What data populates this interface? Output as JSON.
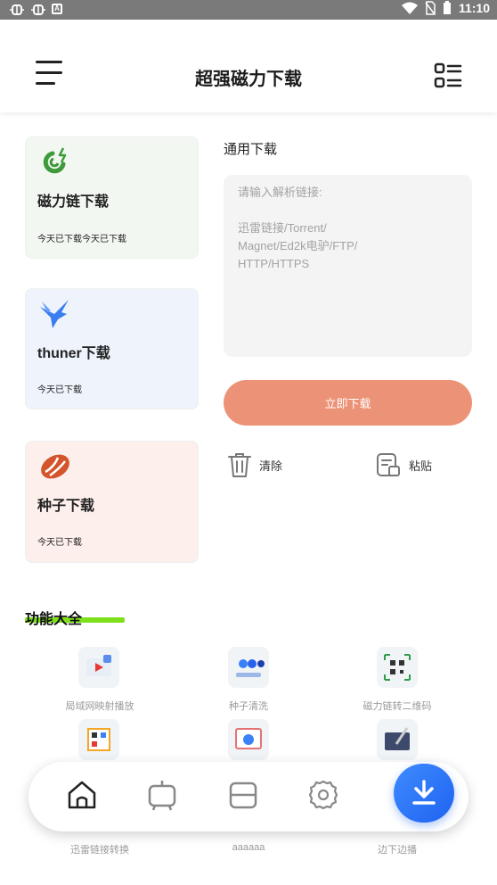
{
  "status_bar": {
    "time": "11:10",
    "left_icons": [
      "bug-icon",
      "bug-icon",
      "a-box-icon"
    ],
    "right_icons": [
      "wifi-icon",
      "no-sim-icon",
      "battery-icon"
    ]
  },
  "header": {
    "title": "超强磁力下载"
  },
  "cards": [
    {
      "title": "磁力链下载",
      "sub": "今天已下载今天已下载",
      "icon": "magnet-icon",
      "color": "#f3f7f2"
    },
    {
      "title": "thuner下载",
      "sub": "今天已下载",
      "icon": "bird-icon",
      "color": "#eef3fc"
    },
    {
      "title": "种子下载",
      "sub": "今天已下载",
      "icon": "seed-icon",
      "color": "#fcefec"
    }
  ],
  "general": {
    "label": "通用下载",
    "placeholder": "请输入解析链接:\n\n迅雷链接/Torrent/\nMagnet/Ed2k电驴/FTP/\nHTTP/HTTPS",
    "download_label": "立即下载",
    "clear_label": "清除",
    "paste_label": "粘贴"
  },
  "features": {
    "title": "功能大全",
    "items": [
      {
        "label": "局域网映射播放",
        "icon": "screen-cast-icon"
      },
      {
        "label": "种子清洗",
        "icon": "gears-icon"
      },
      {
        "label": "磁力链转二维码",
        "icon": "qr-code-icon"
      },
      {
        "label": "",
        "icon": "qr-scan-icon"
      },
      {
        "label": "",
        "icon": "browser-search-icon"
      },
      {
        "label": "",
        "icon": "pen-board-icon"
      },
      {
        "label": "迅雷链接转换",
        "icon": ""
      },
      {
        "label": "aaaaaa",
        "icon": ""
      },
      {
        "label": "边下边播",
        "icon": ""
      }
    ]
  },
  "nav": {
    "items": [
      "home-icon",
      "tv-icon",
      "layout-icon",
      "settings-icon"
    ],
    "fab_icon": "download-icon"
  },
  "colors": {
    "accent_button": "#ec9276",
    "fab": "#2f7bff",
    "underline": "#7ee01c"
  }
}
